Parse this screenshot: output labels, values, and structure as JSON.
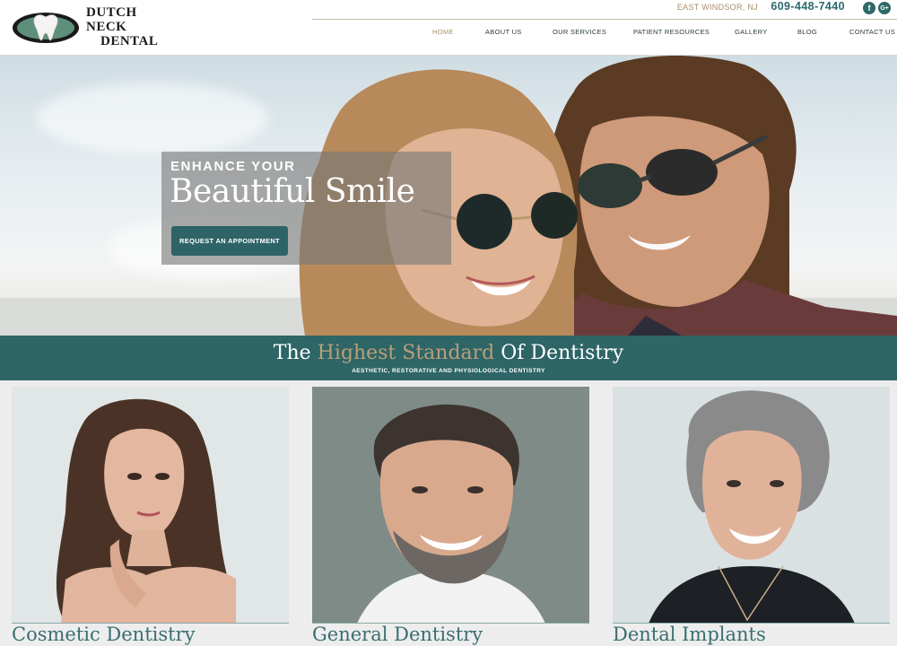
{
  "header": {
    "logo": {
      "line1": "DUTCH NECK",
      "line2": "DENTAL"
    },
    "location": "EAST WINDSOR, NJ",
    "phone": "609-448-7440",
    "social": [
      {
        "name": "facebook",
        "glyph": "f"
      },
      {
        "name": "google-plus",
        "glyph": "G+"
      }
    ],
    "nav": [
      {
        "label": "HOME",
        "active": true
      },
      {
        "label": "ABOUT US",
        "active": false
      },
      {
        "label": "OUR SERVICES",
        "active": false
      },
      {
        "label": "PATIENT RESOURCES",
        "active": false
      },
      {
        "label": "GALLERY",
        "active": false
      },
      {
        "label": "BLOG",
        "active": false
      },
      {
        "label": "CONTACT US",
        "active": false
      }
    ]
  },
  "hero": {
    "kicker": "ENHANCE YOUR",
    "title": "Beautiful Smile",
    "button_label": "REQUEST AN APPOINTMENT"
  },
  "band": {
    "title_pre": "The ",
    "title_accent": "Highest Standard",
    "title_post": " Of Dentistry",
    "subtitle": "AESTHETIC, RESTORATIVE AND PHYSIOLOGICAL DENTISTRY"
  },
  "services": [
    {
      "label": "Cosmetic Dentistry"
    },
    {
      "label": "General Dentistry"
    },
    {
      "label": "Dental Implants"
    }
  ],
  "colors": {
    "teal": "#2e6567",
    "gold": "#a88f6a",
    "accent_gold": "#b99f78",
    "phone": "#2c6a6e"
  }
}
